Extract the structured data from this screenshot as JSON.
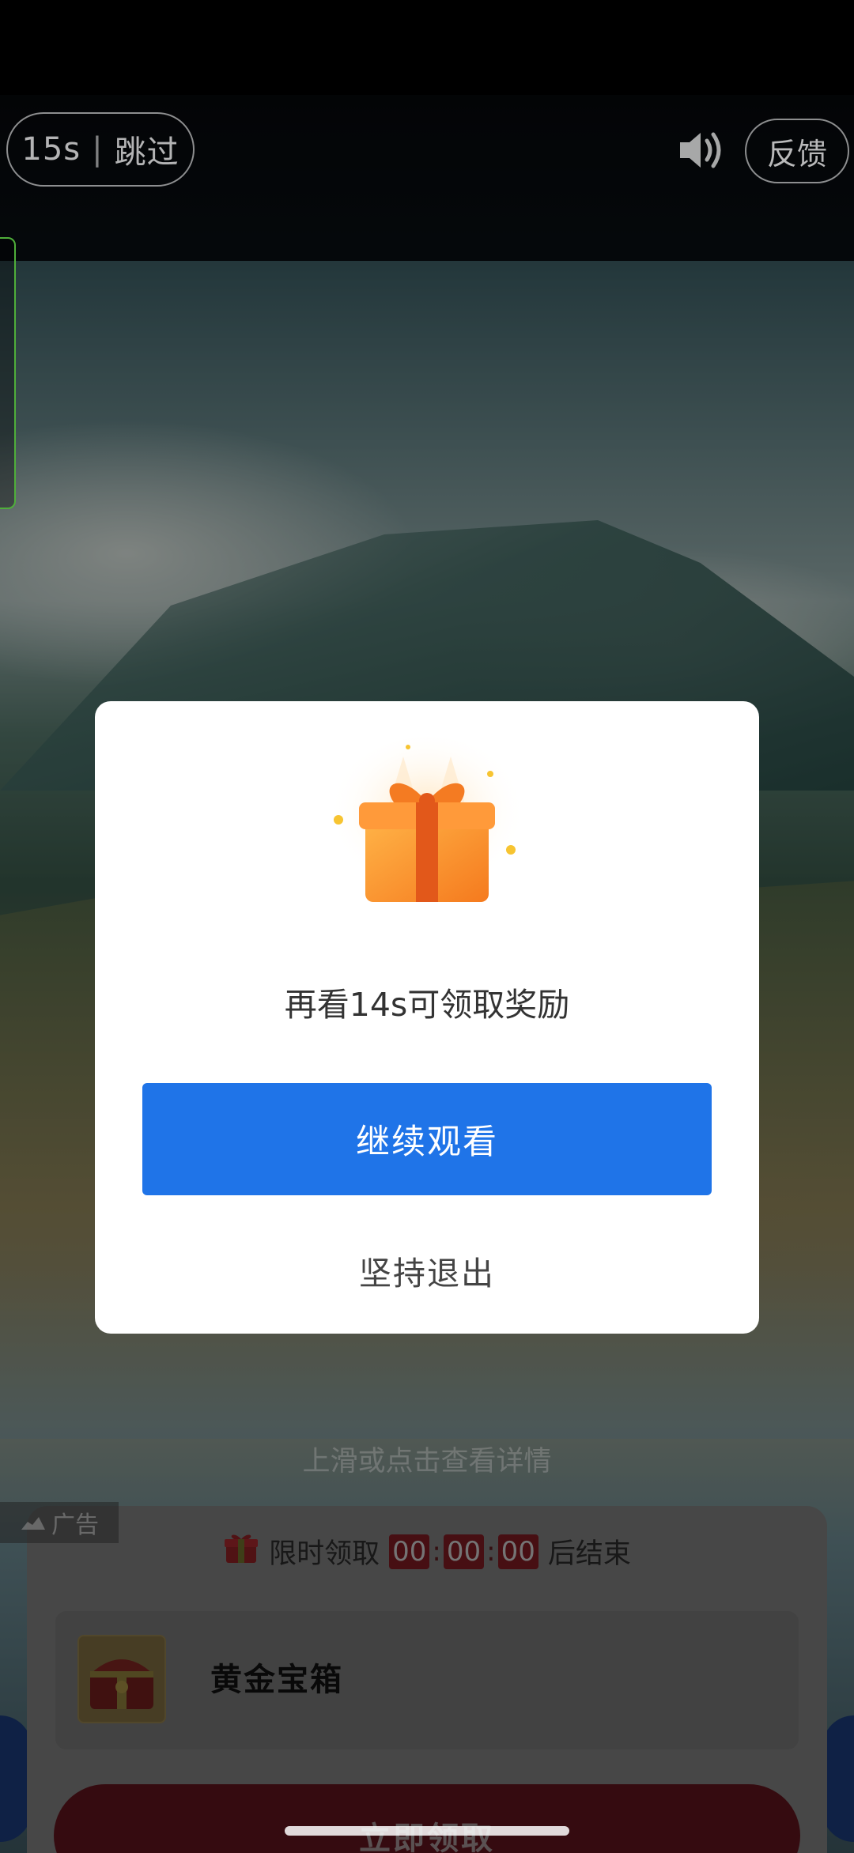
{
  "top_bar": {
    "skip_countdown": "15s",
    "skip_label": "跳过",
    "skip_separator": "|",
    "sound_icon": "speaker-on-icon",
    "feedback_label": "反馈"
  },
  "dialog": {
    "gift_icon": "gift-box-icon",
    "message": "再看14s可领取奖励",
    "continue_label": "继续观看",
    "quit_label": "坚持退出"
  },
  "ad": {
    "swipe_hint": "上滑或点击查看详情",
    "ad_tag": "广告",
    "timer_prefix": "限时领取",
    "timer_hours": "00",
    "timer_minutes": "00",
    "timer_seconds": "00",
    "timer_suffix": "后结束",
    "product_name": "黄金宝箱",
    "product_icon": "treasure-chest-icon",
    "claim_label": "立即领取"
  },
  "colors": {
    "primary_blue": "#1f74e8",
    "claim_red": "#c8102e",
    "dialog_bg": "#ffffff"
  }
}
